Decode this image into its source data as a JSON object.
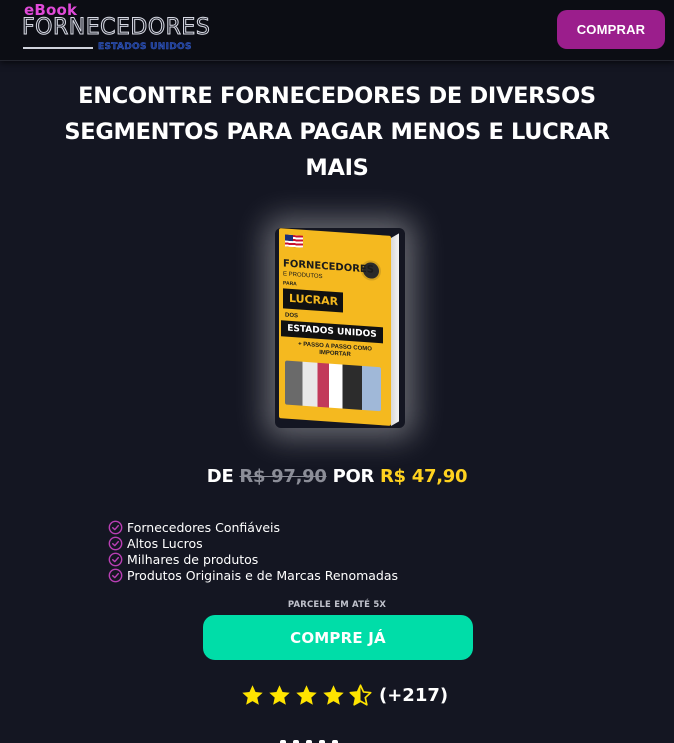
{
  "header": {
    "logo": {
      "small": "eBook",
      "main": "FORNECEDORES",
      "sub": "ESTADOS UNIDOS"
    },
    "buy_label": "COMPRAR"
  },
  "headline": "ENCONTRE FORNECEDORES DE DIVERSOS SEGMENTOS PARA PAGAR MENOS E LUCRAR MAIS",
  "book": {
    "cover_title": "FORNECEDORES",
    "cover_subtitle": "E PRODUTOS",
    "cover_para": "PARA",
    "cover_highlight": "LUCRAR",
    "cover_dos": "DOS",
    "cover_country": "ESTADOS UNIDOS",
    "cover_tagline": "+ PASSO A PASSO COMO IMPORTAR"
  },
  "price": {
    "from_label": "DE",
    "old_value": "R$ 97,90",
    "to_label": "POR",
    "new_value": "R$ 47,90"
  },
  "features": [
    "Fornecedores Confiáveis",
    "Altos Lucros",
    "Milhares de produtos",
    "Produtos Originais e de Marcas Renomadas"
  ],
  "installments": "PARCELE EM ATÉ 5X",
  "buy_main_label": "COMPRE JÁ",
  "rating": {
    "value": 4.5,
    "max": 5,
    "count_label": "(+217)"
  },
  "colors": {
    "background": "#141622",
    "header_bg": "#0c0d14",
    "accent_purple": "#9b1e8c",
    "accent_green": "#00dda8",
    "price_yellow": "#ffd21f",
    "check_purple": "#b93fb4",
    "star_yellow": "#ffe400"
  },
  "icons": {
    "check": "check-circle-icon",
    "star_full": "star-icon",
    "star_half": "star-half-icon"
  }
}
